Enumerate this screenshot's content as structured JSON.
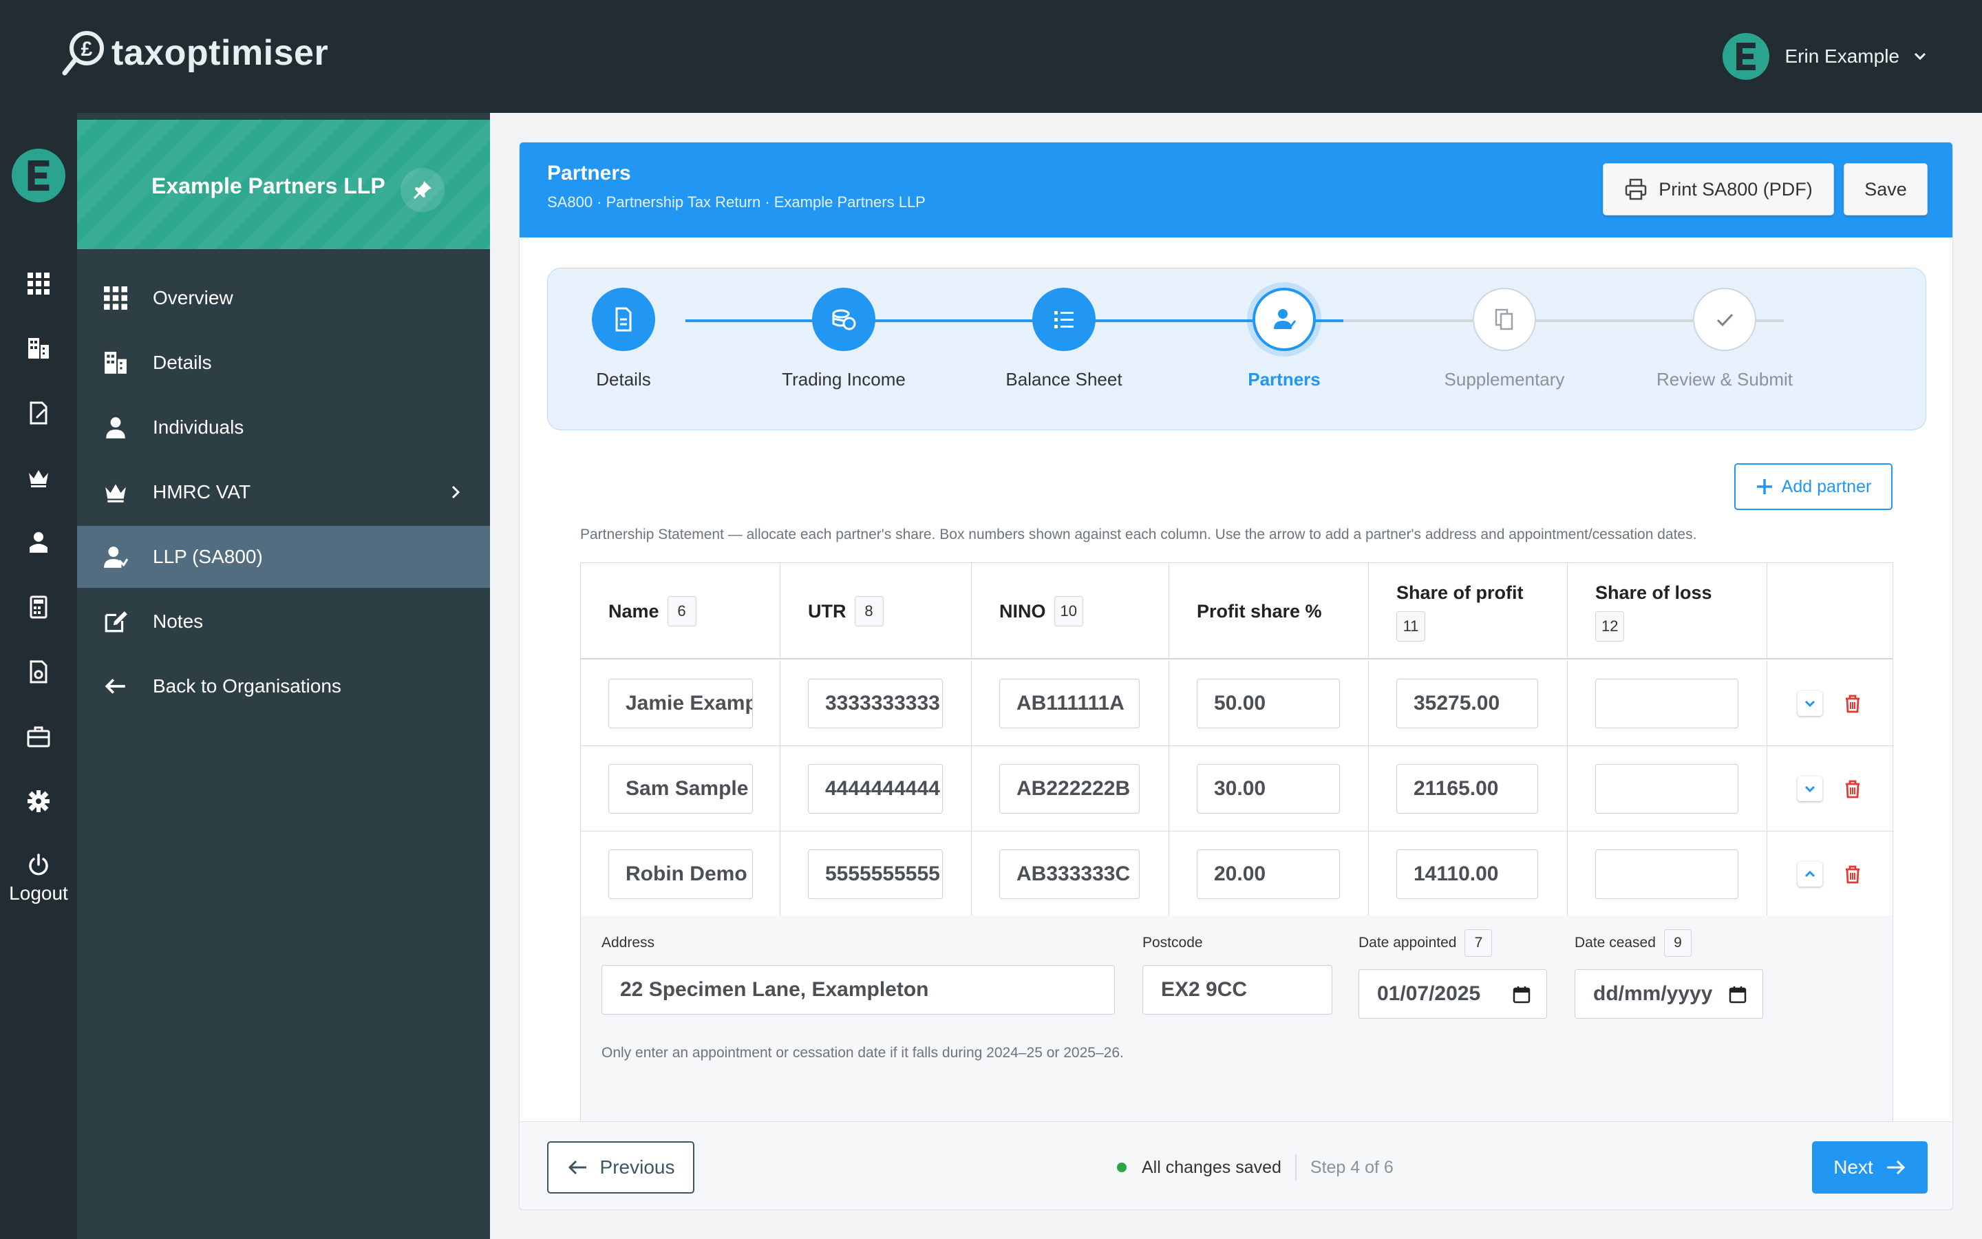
{
  "app": {
    "logo_text": "taxoptimiser",
    "user_name": "Erin Example",
    "avatar_letter": "E"
  },
  "rail": {
    "logout_label": "Logout"
  },
  "sidebar": {
    "org_name": "Example Partners LLP",
    "items": [
      {
        "label": "Overview",
        "icon": "grid-icon"
      },
      {
        "label": "Details",
        "icon": "building-icon"
      },
      {
        "label": "Individuals",
        "icon": "person-icon"
      },
      {
        "label": "HMRC VAT",
        "icon": "crown-icon"
      },
      {
        "label": "LLP (SA800)",
        "icon": "partners-icon"
      },
      {
        "label": "Notes",
        "icon": "edit-icon"
      },
      {
        "label": "Back to Organisations",
        "icon": "arrow-left-icon"
      }
    ]
  },
  "header": {
    "title": "Partners",
    "subtitle": "SA800 · Partnership Tax Return · Example Partners LLP",
    "print_label": "Print SA800 (PDF)",
    "save_label": "Save"
  },
  "stepper": {
    "steps": [
      {
        "label": "Details",
        "state": "done"
      },
      {
        "label": "Trading Income",
        "state": "done"
      },
      {
        "label": "Balance Sheet",
        "state": "done"
      },
      {
        "label": "Partners",
        "state": "current"
      },
      {
        "label": "Supplementary",
        "state": "future"
      },
      {
        "label": "Review & Submit",
        "state": "future"
      }
    ]
  },
  "partners": {
    "add_label": "Add partner",
    "instructions": "Partnership Statement — allocate each partner's share. Box numbers shown against each column. Use the arrow to add a partner's address and appointment/cessation dates.",
    "columns": [
      {
        "label": "Name",
        "box": "6"
      },
      {
        "label": "UTR",
        "box": "8"
      },
      {
        "label": "NINO",
        "box": "10"
      },
      {
        "label": "Profit share %",
        "box": ""
      },
      {
        "label": "Share of profit",
        "box": "11"
      },
      {
        "label": "Share of loss",
        "box": "12"
      }
    ],
    "rows": [
      {
        "name": "Jamie Example",
        "utr": "3333333333",
        "nino": "AB111111A",
        "profit_pct": "50.00",
        "share_profit": "35275.00",
        "share_loss": ""
      },
      {
        "name": "Sam Sample",
        "utr": "4444444444",
        "nino": "AB222222B",
        "profit_pct": "30.00",
        "share_profit": "21165.00",
        "share_loss": ""
      },
      {
        "name": "Robin Demo",
        "utr": "5555555555",
        "nino": "AB333333C",
        "profit_pct": "20.00",
        "share_profit": "14110.00",
        "share_loss": ""
      }
    ],
    "detail": {
      "address_label": "Address",
      "address_value": "22 Specimen Lane, Exampleton",
      "postcode_label": "Postcode",
      "postcode_value": "EX2 9CC",
      "appointed_label": "Date appointed",
      "appointed_box": "7",
      "appointed_value": "01/07/2025",
      "ceased_label": "Date ceased",
      "ceased_box": "9",
      "ceased_value": "dd/mm/yyyy",
      "hint": "Only enter an appointment or cessation date if it falls during 2024–25 or 2025–26."
    }
  },
  "footer": {
    "prev_label": "Previous",
    "saved_label": "All changes saved",
    "step_label": "Step 4 of 6",
    "next_label": "Next"
  },
  "colors": {
    "primary": "#2196f3",
    "teal": "#2ea88f",
    "dark": "#222d33",
    "sidebar": "#2d3e45",
    "danger": "#e53935",
    "success": "#28a745"
  }
}
